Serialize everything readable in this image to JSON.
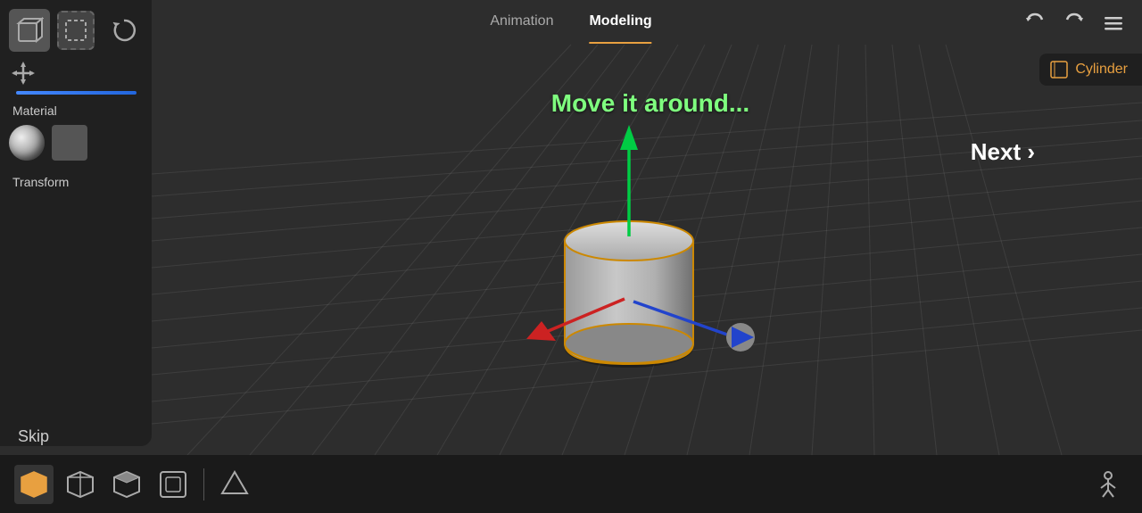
{
  "header": {
    "tab_animation": "Animation",
    "tab_modeling": "Modeling",
    "active_tab": "Modeling"
  },
  "top_controls": {
    "undo_icon": "↩",
    "redo_icon": "↪",
    "menu_icon": "≡"
  },
  "cylinder_label": {
    "text": "Cylinder",
    "icon": "⬜"
  },
  "instruction": {
    "text": "Move it around..."
  },
  "next_button": {
    "label": "Next ›"
  },
  "left_panel": {
    "material_label": "Material",
    "transform_label": "Transform"
  },
  "skip_button": {
    "label": "Skip"
  },
  "bottom_tools": [
    {
      "name": "object-mode",
      "icon": "cube_solid",
      "active": true
    },
    {
      "name": "edit-mode",
      "icon": "cube_outline",
      "active": false
    },
    {
      "name": "sculpt-mode",
      "icon": "cube_partial",
      "active": false
    },
    {
      "name": "texture-mode",
      "icon": "cube_flat",
      "active": false
    },
    {
      "name": "node-mode",
      "icon": "diamond",
      "active": false
    }
  ],
  "colors": {
    "accent_orange": "#e8a040",
    "axis_green": "#00cc44",
    "axis_red": "#cc2222",
    "axis_blue": "#2244cc",
    "instruction_green": "#7fff7f",
    "bg_dark": "#2d2d2d",
    "panel_bg": "#1e1e1e"
  }
}
